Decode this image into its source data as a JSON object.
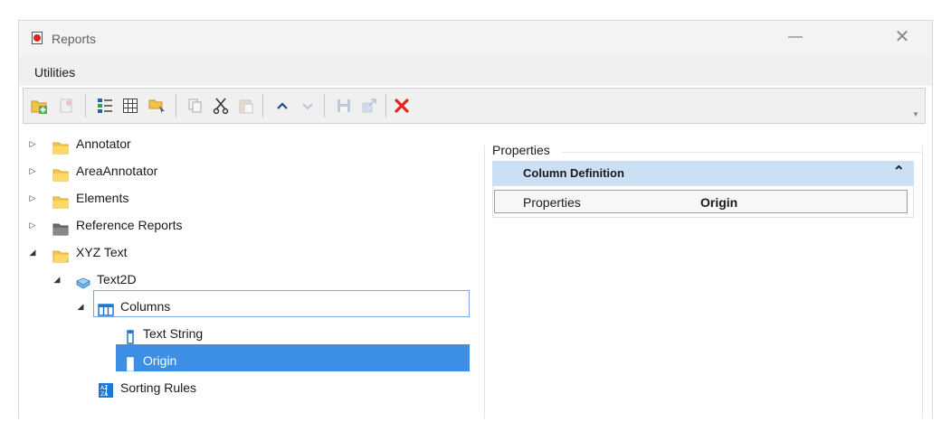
{
  "window": {
    "title": "Reports",
    "minimize_glyph": "—",
    "close_glyph": "✕"
  },
  "menu": {
    "items": [
      "Utilities"
    ]
  },
  "toolbar": {
    "icons": [
      "add-folder-icon",
      "add-report-icon",
      "list-columns-icon",
      "table-icon",
      "select-items-icon",
      "copy-icon",
      "cut-icon",
      "paste-icon",
      "move-up-icon",
      "move-down-icon",
      "save-icon",
      "export-icon",
      "delete-icon"
    ],
    "colors": {
      "delete": "#e8231c",
      "arrow_up": "#1f4a8c"
    }
  },
  "tree": {
    "items": [
      {
        "label": "Annotator",
        "expander": "▷",
        "icon": "folder-icon"
      },
      {
        "label": "AreaAnnotator",
        "expander": "▷",
        "icon": "folder-icon"
      },
      {
        "label": "Elements",
        "expander": "▷",
        "icon": "folder-icon"
      },
      {
        "label": "Reference Reports",
        "expander": "▷",
        "icon": "folder-gray-icon"
      },
      {
        "label": "XYZ Text",
        "expander": "◢",
        "icon": "folder-open-icon"
      },
      {
        "label": "Text2D",
        "expander": "◢",
        "icon": "element-type-icon"
      },
      {
        "label": "Columns",
        "expander": "◢",
        "icon": "columns-icon"
      },
      {
        "label": "Text String",
        "expander": "",
        "icon": "column-icon"
      },
      {
        "label": "Origin",
        "expander": "",
        "icon": "column-icon"
      },
      {
        "label": "Sorting Rules",
        "expander": "",
        "icon": "sorting-rules-icon"
      }
    ],
    "selected": "Origin",
    "selection_color": "#3d8fe6"
  },
  "properties": {
    "title": "Properties",
    "section": "Column Definition",
    "rows": [
      {
        "key": "Properties",
        "value": "Origin"
      }
    ]
  }
}
